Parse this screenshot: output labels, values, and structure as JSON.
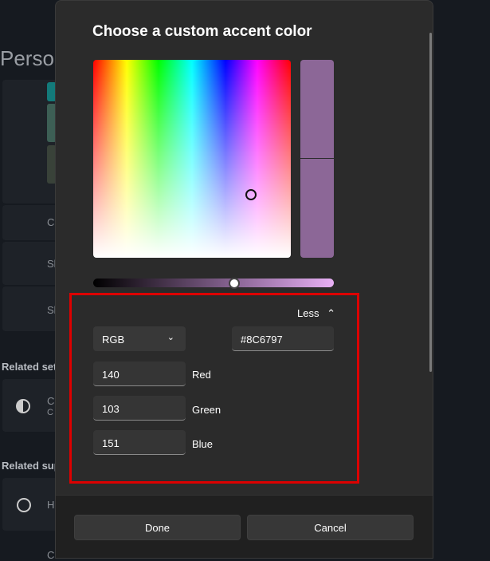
{
  "background": {
    "page_title": "Perso",
    "section_related_settings": "Related set",
    "section_related_support": "Related sup",
    "row_labels": [
      "C",
      "Sl",
      "Sl"
    ],
    "contrast_item": "C",
    "contrast_sub": "C",
    "help_item": "H",
    "bottom_item": "Ch"
  },
  "dialog": {
    "title": "Choose a custom accent color",
    "selected_color": "#8C6797",
    "less_label": "Less",
    "mode": "RGB",
    "hex": "#8C6797",
    "red": {
      "value": "140",
      "label": "Red"
    },
    "green": {
      "value": "103",
      "label": "Green"
    },
    "blue": {
      "value": "151",
      "label": "Blue"
    },
    "done": "Done",
    "cancel": "Cancel"
  }
}
